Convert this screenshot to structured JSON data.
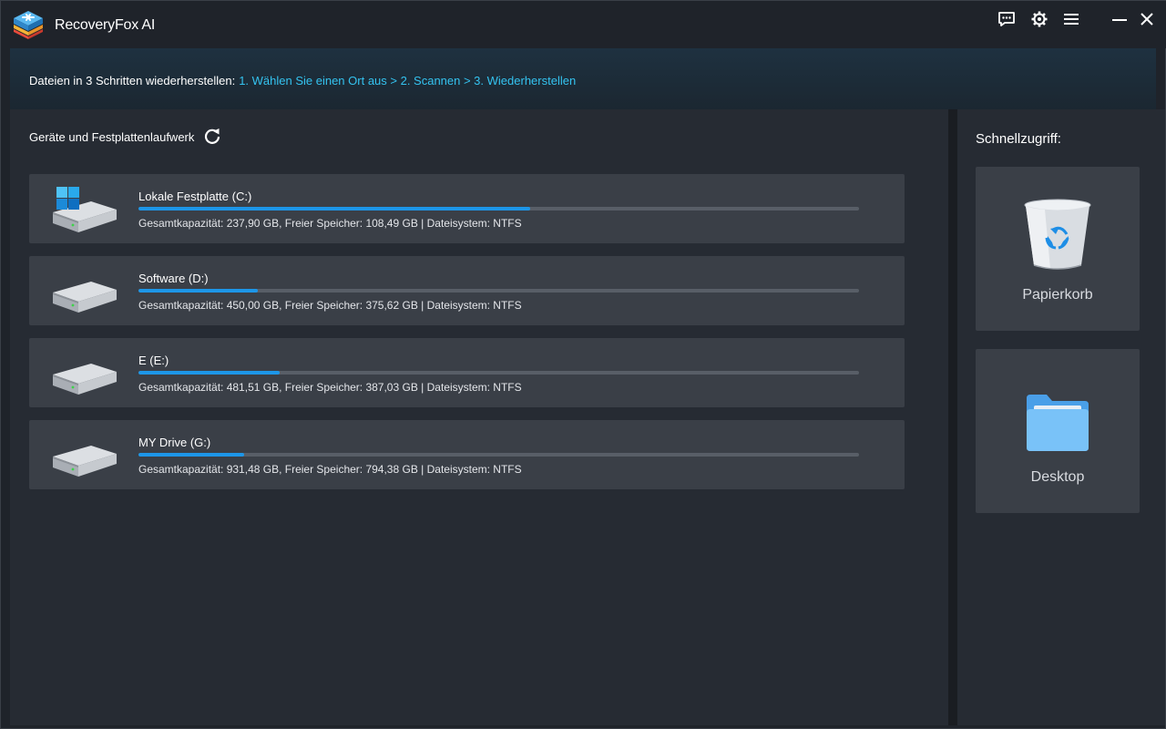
{
  "app": {
    "title": "RecoveryFox AI"
  },
  "titlebar": {
    "icons": [
      "feedback-icon",
      "settings-icon",
      "menu-icon",
      "minimize-icon",
      "close-icon"
    ]
  },
  "steps": {
    "prefix": "Dateien in 3 Schritten wiederherstellen:",
    "highlight": "1. Wählen Sie einen Ort aus > 2. Scannen > 3. Wiederherstellen"
  },
  "devices": {
    "title": "Geräte und Festplattenlaufwerk",
    "drives": [
      {
        "name": "Lokale Festplatte (C:)",
        "info": "Gesamtkapazität: 237,90 GB, Freier Speicher: 108,49 GB | Dateisystem: NTFS",
        "used_fraction": 0.544,
        "icon": "windows-drive-icon"
      },
      {
        "name": "Software (D:)",
        "info": "Gesamtkapazität: 450,00 GB, Freier Speicher: 375,62 GB | Dateisystem: NTFS",
        "used_fraction": 0.165,
        "icon": "drive-icon"
      },
      {
        "name": "E (E:)",
        "info": "Gesamtkapazität: 481,51 GB, Freier Speicher: 387,03 GB | Dateisystem: NTFS",
        "used_fraction": 0.196,
        "icon": "drive-icon"
      },
      {
        "name": "MY Drive (G:)",
        "info": "Gesamtkapazität: 931,48 GB, Freier Speicher: 794,38 GB | Dateisystem: NTFS",
        "used_fraction": 0.147,
        "icon": "drive-icon"
      }
    ]
  },
  "quick_access": {
    "title": "Schnellzugriff:",
    "items": [
      {
        "label": "Papierkorb",
        "icon": "recycle-bin-icon"
      },
      {
        "label": "Desktop",
        "icon": "folder-icon"
      }
    ]
  },
  "colors": {
    "accent": "#1d96e8",
    "step_highlight": "#34c3f0",
    "card_bg": "#3a3f47",
    "panel_bg": "#262b33"
  }
}
